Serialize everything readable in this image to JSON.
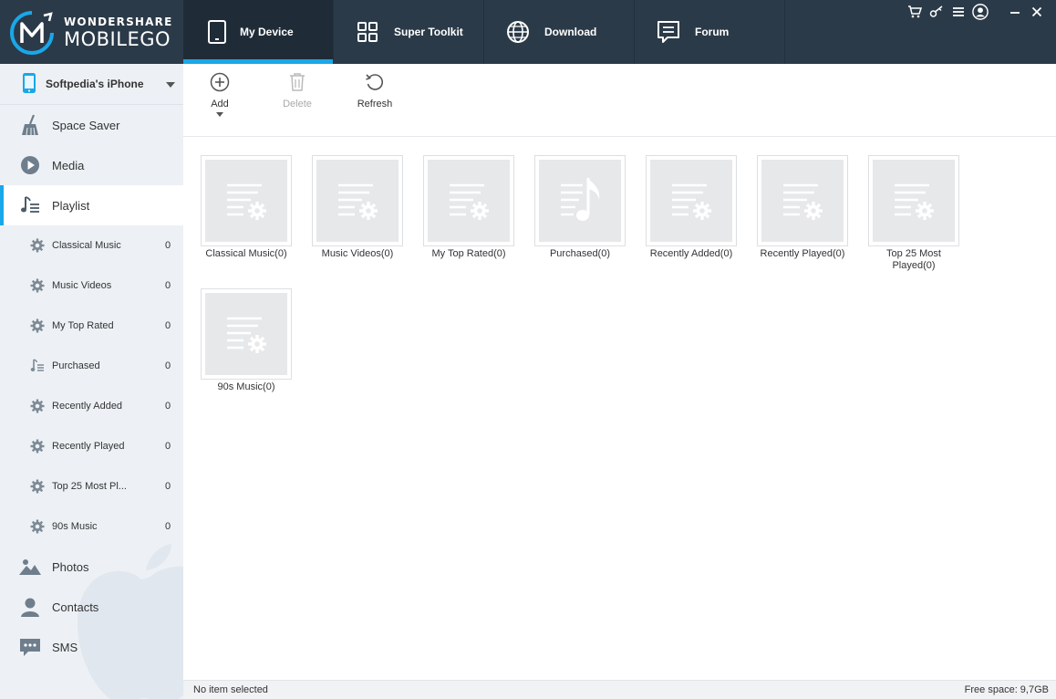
{
  "app": {
    "brand": "WONDERSHARE",
    "product": "MOBILEGO"
  },
  "tabs": [
    {
      "label": "My Device",
      "icon": "tablet-icon"
    },
    {
      "label": "Super Toolkit",
      "icon": "grid-icon"
    },
    {
      "label": "Download",
      "icon": "globe-icon"
    },
    {
      "label": "Forum",
      "icon": "chat-icon"
    }
  ],
  "window_controls": [
    "cart-icon",
    "key-icon",
    "menu-icon",
    "account-icon",
    "minimize-icon",
    "close-icon"
  ],
  "sidebar": {
    "device_name": "Softpedia's iPhone",
    "nav": [
      {
        "label": "Space Saver",
        "icon": "broom-icon"
      },
      {
        "label": "Media",
        "icon": "play-icon"
      },
      {
        "label": "Playlist",
        "icon": "playlist-icon"
      },
      {
        "label": "Photos",
        "icon": "photos-icon"
      },
      {
        "label": "Contacts",
        "icon": "contacts-icon"
      },
      {
        "label": "SMS",
        "icon": "sms-icon"
      }
    ],
    "playlists": [
      {
        "label": "Classical Music",
        "count": "0",
        "icon": "gear-icon"
      },
      {
        "label": "Music Videos",
        "count": "0",
        "icon": "gear-icon"
      },
      {
        "label": "My Top Rated",
        "count": "0",
        "icon": "gear-icon"
      },
      {
        "label": "Purchased",
        "count": "0",
        "icon": "playlist-icon"
      },
      {
        "label": "Recently Added",
        "count": "0",
        "icon": "gear-icon"
      },
      {
        "label": "Recently Played",
        "count": "0",
        "icon": "gear-icon"
      },
      {
        "label": "Top 25 Most Pl...",
        "count": "0",
        "icon": "gear-icon"
      },
      {
        "label": "90s Music",
        "count": "0",
        "icon": "gear-icon"
      }
    ]
  },
  "toolbar": {
    "add_label": "Add",
    "delete_label": "Delete",
    "refresh_label": "Refresh"
  },
  "grid": [
    {
      "caption": "Classical Music(0)",
      "type": "smart"
    },
    {
      "caption": "Music Videos(0)",
      "type": "smart"
    },
    {
      "caption": "My Top Rated(0)",
      "type": "smart"
    },
    {
      "caption": "Purchased(0)",
      "type": "music"
    },
    {
      "caption": "Recently Added(0)",
      "type": "smart"
    },
    {
      "caption": "Recently Played(0)",
      "type": "smart"
    },
    {
      "caption": "Top 25 Most Played(0)",
      "type": "smart"
    },
    {
      "caption": "90s Music(0)",
      "type": "smart"
    }
  ],
  "status": {
    "left": "No item selected",
    "right": "Free space: 9,7GB"
  },
  "colors": {
    "topbar": "#2b3a48",
    "accent": "#1aa7e8",
    "sidebar": "#edf1f5",
    "icon_gray": "#6f7e8c"
  }
}
